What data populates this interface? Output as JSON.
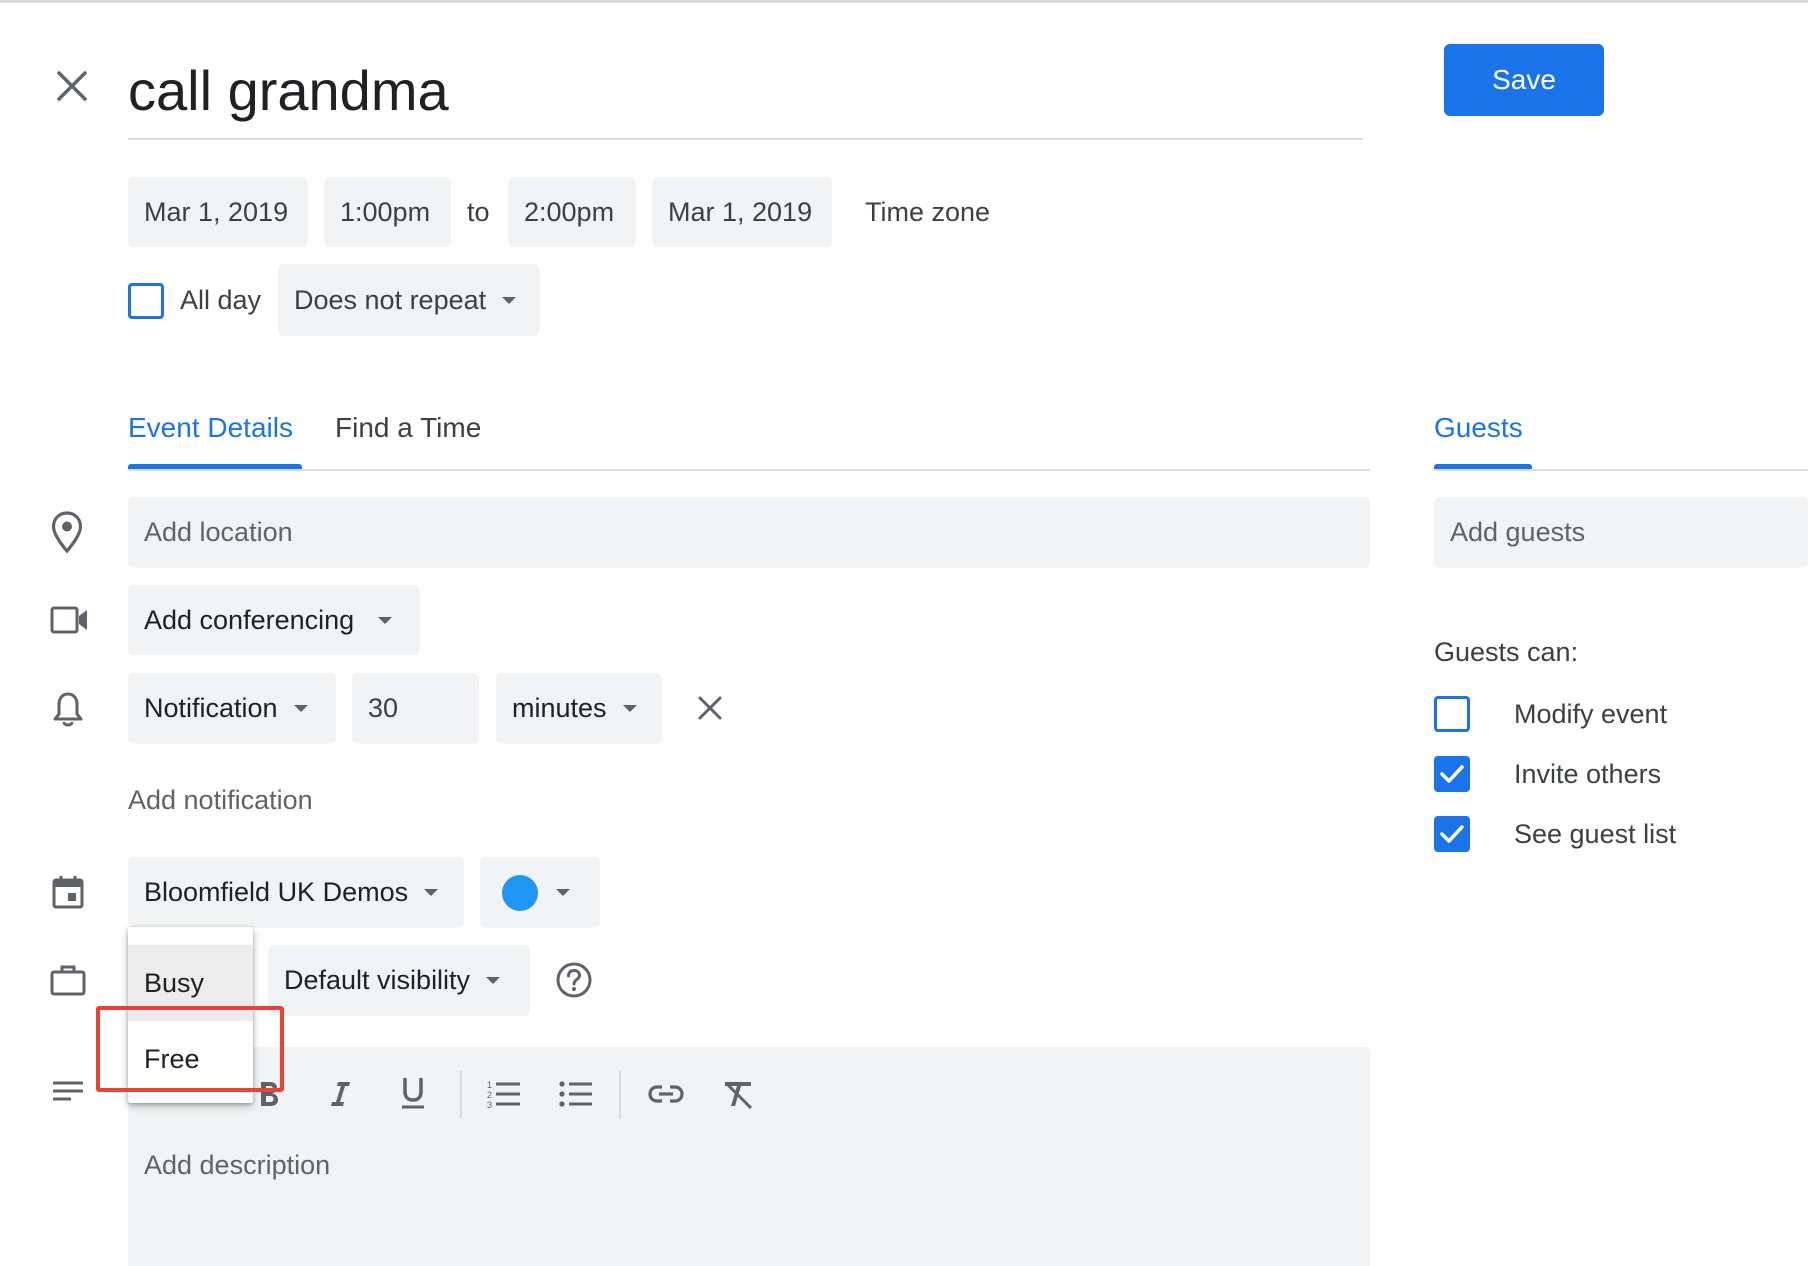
{
  "event": {
    "title": "call grandma",
    "save_label": "Save"
  },
  "datetime": {
    "start_date": "Mar 1, 2019",
    "start_time": "1:00pm",
    "to_label": "to",
    "end_time": "2:00pm",
    "end_date": "Mar 1, 2019",
    "timezone_label": "Time zone"
  },
  "all_day": {
    "label": "All day",
    "checked": false
  },
  "repeat": {
    "selected": "Does not repeat"
  },
  "tabs": [
    {
      "label": "Event Details",
      "active": true
    },
    {
      "label": "Find a Time",
      "active": false
    }
  ],
  "guests_tab": {
    "label": "Guests"
  },
  "location": {
    "placeholder": "Add location"
  },
  "conferencing": {
    "label": "Add conferencing"
  },
  "notification": {
    "type": "Notification",
    "value": "30",
    "unit": "minutes",
    "add_label": "Add notification"
  },
  "calendar": {
    "name": "Bloomfield UK Demos",
    "color": "#2196f3"
  },
  "availability_menu": {
    "options": [
      "Busy",
      "Free"
    ],
    "hovered": "Busy",
    "highlighted": "Free"
  },
  "visibility": {
    "selected": "Default visibility"
  },
  "description": {
    "placeholder": "Add description"
  },
  "guests": {
    "placeholder": "Add guests",
    "can_label": "Guests can:",
    "permissions": [
      {
        "label": "Modify event",
        "checked": false
      },
      {
        "label": "Invite others",
        "checked": true
      },
      {
        "label": "See guest list",
        "checked": true
      }
    ]
  },
  "colors": {
    "accent": "#1a73e8",
    "field_bg": "#f1f3f4",
    "highlight": "#ea4335"
  },
  "icons": [
    "close-icon",
    "location-pin-icon",
    "video-camera-icon",
    "bell-icon",
    "calendar-icon",
    "briefcase-icon",
    "help-circle-icon",
    "description-lines-icon",
    "bold-icon",
    "italic-icon",
    "underline-icon",
    "numbered-list-icon",
    "bullet-list-icon",
    "link-icon",
    "clear-format-icon",
    "checkmark-icon"
  ]
}
